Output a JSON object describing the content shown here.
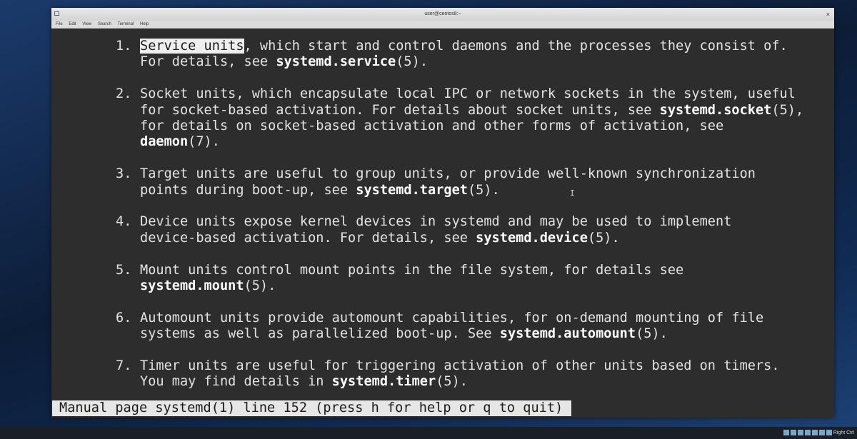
{
  "window": {
    "title": "user@centos8:~",
    "menu": [
      "File",
      "Edit",
      "View",
      "Search",
      "Terminal",
      "Help"
    ]
  },
  "manpage": {
    "items": [
      {
        "num": "1.",
        "lines": [
          [
            {
              "t": "Service units",
              "s": "hl"
            },
            {
              "t": ", which start and control daemons and the processes they consist of."
            }
          ],
          [
            {
              "t": "For details, see "
            },
            {
              "t": "systemd.service",
              "s": "b"
            },
            {
              "t": "(5)."
            }
          ]
        ]
      },
      {
        "num": "2.",
        "lines": [
          [
            {
              "t": "Socket units, which encapsulate local IPC or network sockets in the system, useful"
            }
          ],
          [
            {
              "t": "for socket-based activation. For details about socket units, see "
            },
            {
              "t": "systemd.socket",
              "s": "b"
            },
            {
              "t": "(5),"
            }
          ],
          [
            {
              "t": "for details on socket-based activation and other forms of activation, see"
            }
          ],
          [
            {
              "t": "daemon",
              "s": "b"
            },
            {
              "t": "(7)."
            }
          ]
        ]
      },
      {
        "num": "3.",
        "lines": [
          [
            {
              "t": "Target units are useful to group units, or provide well-known synchronization"
            }
          ],
          [
            {
              "t": "points during boot-up, see "
            },
            {
              "t": "systemd.target",
              "s": "b"
            },
            {
              "t": "(5)."
            }
          ]
        ]
      },
      {
        "num": "4.",
        "lines": [
          [
            {
              "t": "Device units expose kernel devices in systemd and may be used to implement"
            }
          ],
          [
            {
              "t": "device-based activation. For details, see "
            },
            {
              "t": "systemd.device",
              "s": "b"
            },
            {
              "t": "(5)."
            }
          ]
        ]
      },
      {
        "num": "5.",
        "lines": [
          [
            {
              "t": "Mount units control mount points in the file system, for details see"
            }
          ],
          [
            {
              "t": "systemd.mount",
              "s": "b"
            },
            {
              "t": "(5)."
            }
          ]
        ]
      },
      {
        "num": "6.",
        "lines": [
          [
            {
              "t": "Automount units provide automount capabilities, for on-demand mounting of file"
            }
          ],
          [
            {
              "t": "systems as well as parallelized boot-up. See "
            },
            {
              "t": "systemd.automount",
              "s": "b"
            },
            {
              "t": "(5)."
            }
          ]
        ]
      },
      {
        "num": "7.",
        "lines": [
          [
            {
              "t": "Timer units are useful for triggering activation of other units based on timers."
            }
          ],
          [
            {
              "t": "You may find details in "
            },
            {
              "t": "systemd.timer",
              "s": "b"
            },
            {
              "t": "(5)."
            }
          ]
        ]
      }
    ],
    "status": "Manual page systemd(1) line 152 (press h for help or q to quit)"
  },
  "taskbar": {
    "tray_label": "Right Ctrl"
  }
}
